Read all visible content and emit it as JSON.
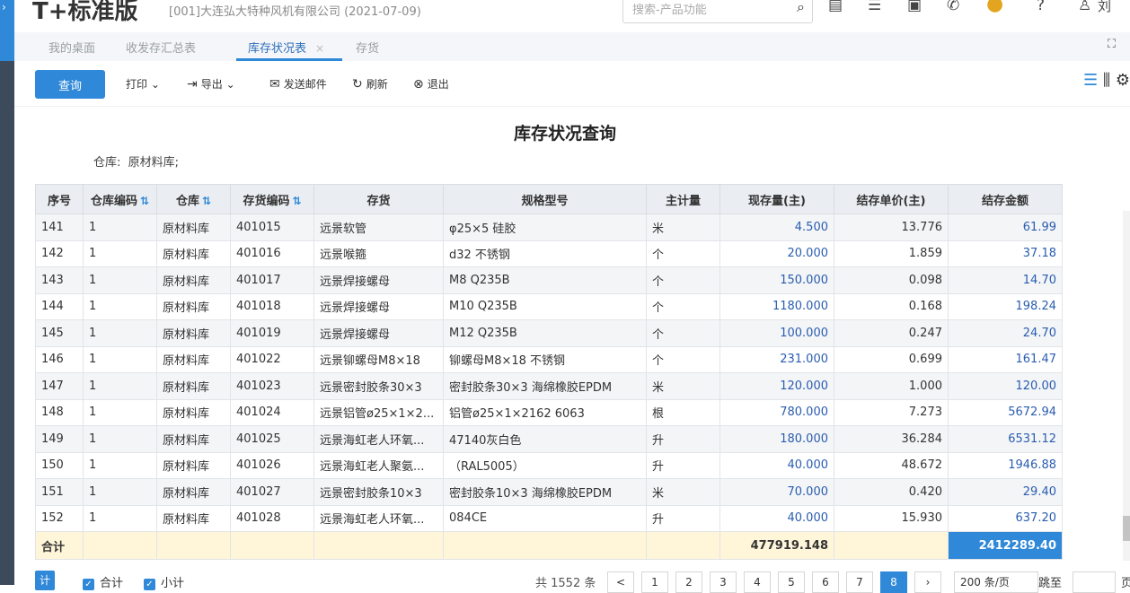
{
  "header": {
    "logo": "T+标准版",
    "company": "[001]大连弘大特种风机有限公司 (2021-07-09)",
    "search_placeholder": "搜索-产品功能",
    "user": "刘"
  },
  "tabs": [
    {
      "label": "我的桌面"
    },
    {
      "label": "收发存汇总表"
    },
    {
      "label": "库存状况表",
      "close": "×"
    },
    {
      "label": "存货"
    }
  ],
  "toolbar": {
    "query": "查询",
    "print": "打印",
    "export": "导出",
    "email": "发送邮件",
    "refresh": "刷新",
    "exit": "退出"
  },
  "report": {
    "title": "库存状况查询",
    "warehouse_label": "仓库:",
    "warehouse_value": "原材料库;"
  },
  "columns": [
    "序号",
    "仓库编码",
    "仓库",
    "存货编码",
    "存货",
    "规格型号",
    "主计量",
    "现存量(主)",
    "结存单价(主)",
    "结存金额"
  ],
  "rows": [
    {
      "seq": "141",
      "wh_code": "1",
      "wh": "原材料库",
      "code": "401015",
      "item": "远景软管",
      "spec": "φ25×5 硅胶",
      "unit": "米",
      "qty": "4.500",
      "price": "13.776",
      "amount": "61.99"
    },
    {
      "seq": "142",
      "wh_code": "1",
      "wh": "原材料库",
      "code": "401016",
      "item": "远景喉箍",
      "spec": "d32 不锈钢",
      "unit": "个",
      "qty": "20.000",
      "price": "1.859",
      "amount": "37.18"
    },
    {
      "seq": "143",
      "wh_code": "1",
      "wh": "原材料库",
      "code": "401017",
      "item": "远景焊接螺母",
      "spec": "M8 Q235B",
      "unit": "个",
      "qty": "150.000",
      "price": "0.098",
      "amount": "14.70"
    },
    {
      "seq": "144",
      "wh_code": "1",
      "wh": "原材料库",
      "code": "401018",
      "item": "远景焊接螺母",
      "spec": "M10 Q235B",
      "unit": "个",
      "qty": "1180.000",
      "price": "0.168",
      "amount": "198.24"
    },
    {
      "seq": "145",
      "wh_code": "1",
      "wh": "原材料库",
      "code": "401019",
      "item": "远景焊接螺母",
      "spec": "M12 Q235B",
      "unit": "个",
      "qty": "100.000",
      "price": "0.247",
      "amount": "24.70"
    },
    {
      "seq": "146",
      "wh_code": "1",
      "wh": "原材料库",
      "code": "401022",
      "item": "远景铆螺母M8×18",
      "spec": "铆螺母M8×18 不锈钢",
      "unit": "个",
      "qty": "231.000",
      "price": "0.699",
      "amount": "161.47"
    },
    {
      "seq": "147",
      "wh_code": "1",
      "wh": "原材料库",
      "code": "401023",
      "item": "远景密封胶条30×3",
      "spec": "密封胶条30×3 海绵橡胶EPDM",
      "unit": "米",
      "qty": "120.000",
      "price": "1.000",
      "amount": "120.00"
    },
    {
      "seq": "148",
      "wh_code": "1",
      "wh": "原材料库",
      "code": "401024",
      "item": "远景铝管ø25×1×2...",
      "spec": "铝管ø25×1×2162 6063",
      "unit": "根",
      "qty": "780.000",
      "price": "7.273",
      "amount": "5672.94"
    },
    {
      "seq": "149",
      "wh_code": "1",
      "wh": "原材料库",
      "code": "401025",
      "item": "远景海虹老人环氧...",
      "spec": "47140灰白色",
      "unit": "升",
      "qty": "180.000",
      "price": "36.284",
      "amount": "6531.12"
    },
    {
      "seq": "150",
      "wh_code": "1",
      "wh": "原材料库",
      "code": "401026",
      "item": "远景海虹老人聚氨...",
      "spec": "（RAL5005）",
      "unit": "升",
      "qty": "40.000",
      "price": "48.672",
      "amount": "1946.88"
    },
    {
      "seq": "151",
      "wh_code": "1",
      "wh": "原材料库",
      "code": "401027",
      "item": "远景密封胶条10×3",
      "spec": "密封胶条10×3 海绵橡胶EPDM",
      "unit": "米",
      "qty": "70.000",
      "price": "0.420",
      "amount": "29.40"
    },
    {
      "seq": "152",
      "wh_code": "1",
      "wh": "原材料库",
      "code": "401028",
      "item": "远景海虹老人环氧...",
      "spec": "084CE",
      "unit": "升",
      "qty": "40.000",
      "price": "15.930",
      "amount": "637.20"
    }
  ],
  "total": {
    "label": "合计",
    "qty": "477919.148",
    "amount": "2412289.40"
  },
  "footer": {
    "btn": "计",
    "check_total": "合计",
    "check_subtotal": "小计",
    "count": "共 1552 条",
    "prev": "<",
    "pages": [
      "1",
      "2",
      "3",
      "4",
      "5",
      "6",
      "7",
      "8"
    ],
    "active_page": "8",
    "page_size": "200 条/页",
    "jump": "跳至",
    "jump_tail": "页"
  }
}
